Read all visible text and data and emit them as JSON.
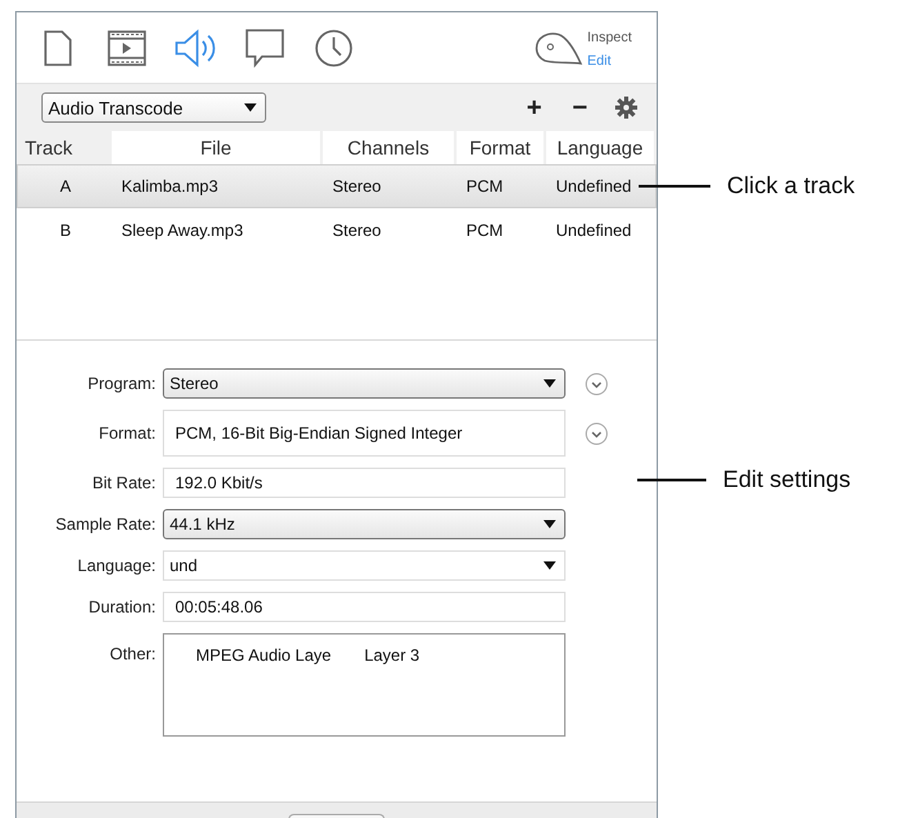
{
  "toolbar": {
    "tabs": [
      {
        "kind": "document",
        "selected": false
      },
      {
        "kind": "video",
        "selected": false
      },
      {
        "kind": "audio",
        "selected": true
      },
      {
        "kind": "subtitle",
        "selected": false
      },
      {
        "kind": "chapters",
        "selected": false
      }
    ],
    "inspector": {
      "title": "Inspect",
      "link": "Edit"
    }
  },
  "preset_bar": {
    "preset": "Audio Transcode",
    "add": "+",
    "remove": "−"
  },
  "table": {
    "columns": [
      "Track",
      "File",
      "Channels",
      "Format",
      "Language"
    ],
    "rows": [
      {
        "cells": [
          "A",
          "Kalimba.mp3",
          "Stereo",
          "PCM",
          "Undefined"
        ],
        "selected": true
      },
      {
        "cells": [
          "B",
          "Sleep Away.mp3",
          "Stereo",
          "PCM",
          "Undefined"
        ],
        "selected": false
      }
    ]
  },
  "settings": [
    {
      "label": "Program:",
      "kind": "select",
      "value": "Stereo",
      "expandable": true
    },
    {
      "label": "Format:",
      "kind": "text",
      "value": "PCM, 16-Bit Big-Endian Signed Integer",
      "expandable": true
    },
    {
      "label": "Bit Rate:",
      "kind": "field",
      "value": "192.0 Kbit/s",
      "expandable": false
    },
    {
      "label": "Sample Rate:",
      "kind": "select",
      "value": "44.1 kHz",
      "expandable": false
    },
    {
      "label": "Language:",
      "kind": "combo",
      "value": "und",
      "expandable": false
    },
    {
      "label": "Duration:",
      "kind": "field",
      "value": "00:05:48.06",
      "expandable": false
    },
    {
      "label": "Other:",
      "kind": "list",
      "items": [
        [
          "MPEG Audio Laye",
          "Layer 3"
        ]
      ],
      "expandable": false
    }
  ],
  "callouts": [
    {
      "text": "Click a track"
    },
    {
      "text": "Edit settings"
    }
  ]
}
